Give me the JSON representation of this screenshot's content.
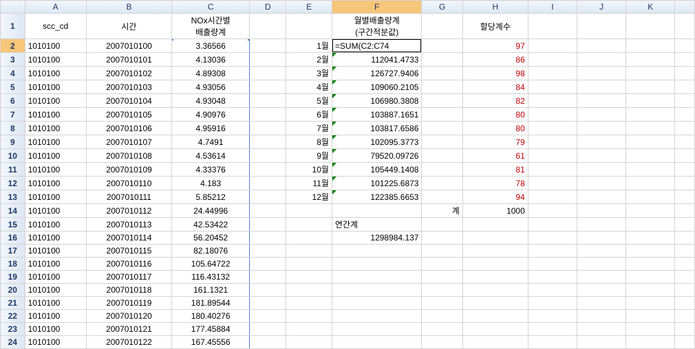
{
  "columns": [
    "A",
    "B",
    "C",
    "D",
    "E",
    "F",
    "G",
    "H",
    "I",
    "J",
    "K"
  ],
  "header_row": {
    "A": "scc_cd",
    "B": "시간",
    "C": "NOx시간별\n배출량계",
    "F": "월별배출량계\n(구간적분값)",
    "H": "할당계수"
  },
  "active_cell_formula": "=SUM(C2:C74",
  "rows": [
    {
      "num": 2,
      "A": "1010100",
      "B": "2007010100",
      "C": "3.36566",
      "E": "1월",
      "F": "",
      "H": "97",
      "H_red": true,
      "active": true
    },
    {
      "num": 3,
      "A": "1010100",
      "B": "2007010101",
      "C": "4.13036",
      "E": "2월",
      "F": "112041.4733",
      "H": "86",
      "H_red": true,
      "F_tri": true
    },
    {
      "num": 4,
      "A": "1010100",
      "B": "2007010102",
      "C": "4.89308",
      "E": "3월",
      "F": "126727.9406",
      "H": "98",
      "H_red": true,
      "F_tri": true
    },
    {
      "num": 5,
      "A": "1010100",
      "B": "2007010103",
      "C": "4.93056",
      "E": "4월",
      "F": "109060.2105",
      "H": "84",
      "H_red": true,
      "F_tri": true
    },
    {
      "num": 6,
      "A": "1010100",
      "B": "2007010104",
      "C": "4.93048",
      "E": "5월",
      "F": "106980.3808",
      "H": "82",
      "H_red": true,
      "F_tri": true
    },
    {
      "num": 7,
      "A": "1010100",
      "B": "2007010105",
      "C": "4.90976",
      "E": "6월",
      "F": "103887.1651",
      "H": "80",
      "H_red": true,
      "F_tri": true
    },
    {
      "num": 8,
      "A": "1010100",
      "B": "2007010106",
      "C": "4.95916",
      "E": "7월",
      "F": "103817.6586",
      "H": "80",
      "H_red": true,
      "F_tri": true
    },
    {
      "num": 9,
      "A": "1010100",
      "B": "2007010107",
      "C": "4.7491",
      "E": "8월",
      "F": "102095.3773",
      "H": "79",
      "H_red": true,
      "F_tri": true
    },
    {
      "num": 10,
      "A": "1010100",
      "B": "2007010108",
      "C": "4.53614",
      "E": "9월",
      "F": "79520.09726",
      "H": "61",
      "H_red": true,
      "F_tri": true
    },
    {
      "num": 11,
      "A": "1010100",
      "B": "2007010109",
      "C": "4.33376",
      "E": "10월",
      "F": "105449.1408",
      "H": "81",
      "H_red": true,
      "F_tri": true
    },
    {
      "num": 12,
      "A": "1010100",
      "B": "2007010110",
      "C": "4.183",
      "E": "11월",
      "F": "101225.6873",
      "H": "78",
      "H_red": true,
      "F_tri": true
    },
    {
      "num": 13,
      "A": "1010100",
      "B": "2007010111",
      "C": "5.85212",
      "E": "12월",
      "F": "122385.6653",
      "H": "94",
      "H_red": true,
      "F_tri": true
    },
    {
      "num": 14,
      "A": "1010100",
      "B": "2007010112",
      "C": "24.44996",
      "G": "계",
      "H": "1000"
    },
    {
      "num": 15,
      "A": "1010100",
      "B": "2007010113",
      "C": "42.53422",
      "F": "연간계",
      "F_align": "left"
    },
    {
      "num": 16,
      "A": "1010100",
      "B": "2007010114",
      "C": "56.20452",
      "F": "1298984.137"
    },
    {
      "num": 17,
      "A": "1010100",
      "B": "2007010115",
      "C": "82.18076"
    },
    {
      "num": 18,
      "A": "1010100",
      "B": "2007010116",
      "C": "105.64722"
    },
    {
      "num": 19,
      "A": "1010100",
      "B": "2007010117",
      "C": "116.43132"
    },
    {
      "num": 20,
      "A": "1010100",
      "B": "2007010118",
      "C": "161.1321"
    },
    {
      "num": 21,
      "A": "1010100",
      "B": "2007010119",
      "C": "181.89544"
    },
    {
      "num": 22,
      "A": "1010100",
      "B": "2007010120",
      "C": "180.40276"
    },
    {
      "num": 23,
      "A": "1010100",
      "B": "2007010121",
      "C": "177.45884"
    },
    {
      "num": 24,
      "A": "1010100",
      "B": "2007010122",
      "C": "167.45556"
    }
  ]
}
